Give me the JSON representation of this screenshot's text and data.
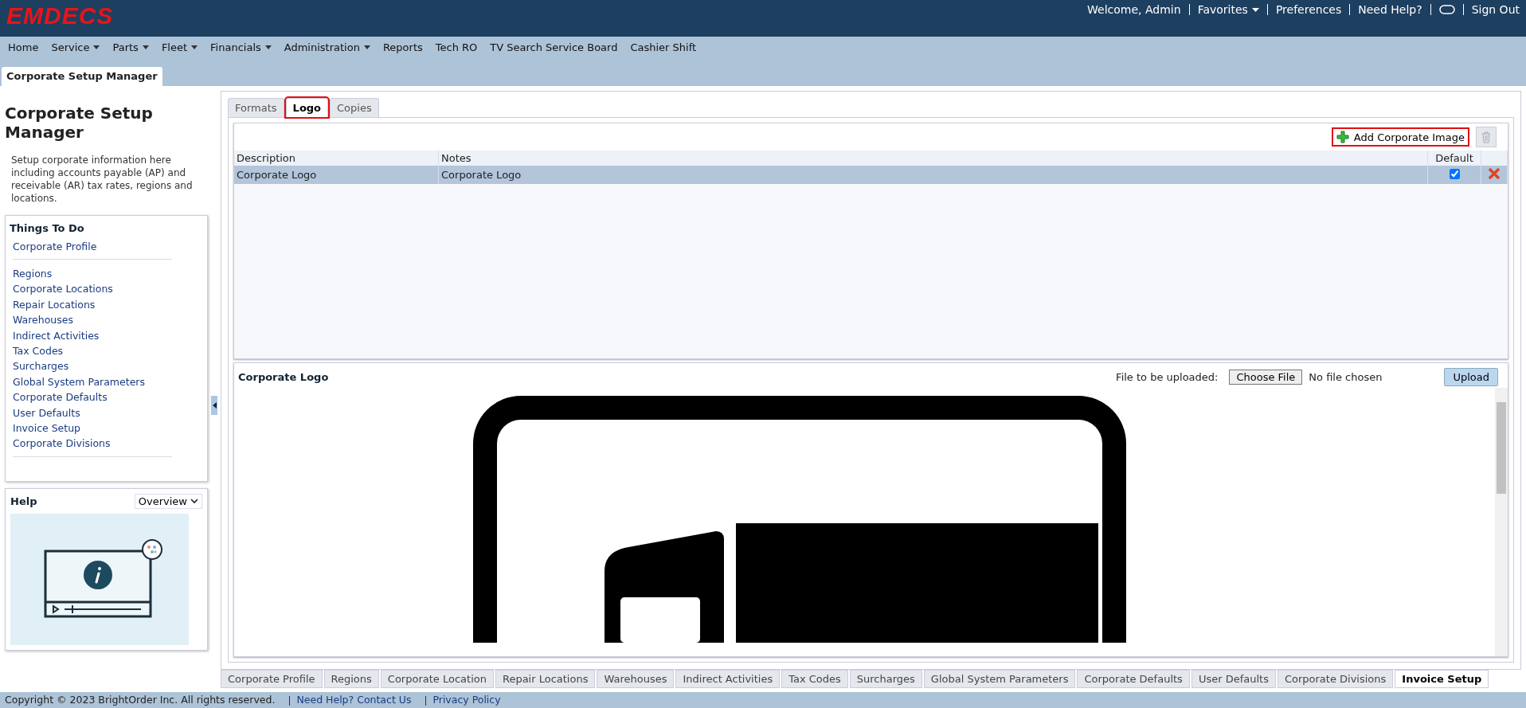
{
  "header": {
    "logo": "EMDECS",
    "welcome": "Welcome, Admin",
    "links": [
      {
        "label": "Favorites",
        "kind": "dropdown"
      },
      {
        "label": "Preferences",
        "kind": "link"
      },
      {
        "label": "Need Help?",
        "kind": "link"
      },
      {
        "kind": "toggle"
      },
      {
        "label": "Sign Out",
        "kind": "link"
      }
    ]
  },
  "nav": [
    {
      "label": "Home",
      "dropdown": false
    },
    {
      "label": "Service",
      "dropdown": true
    },
    {
      "label": "Parts",
      "dropdown": true
    },
    {
      "label": "Fleet",
      "dropdown": true
    },
    {
      "label": "Financials",
      "dropdown": true
    },
    {
      "label": "Administration",
      "dropdown": true
    },
    {
      "label": "Reports",
      "dropdown": false
    },
    {
      "label": "Tech RO",
      "dropdown": false
    },
    {
      "label": "TV Search Service Board",
      "dropdown": false
    },
    {
      "label": "Cashier Shift",
      "dropdown": false
    }
  ],
  "page_tab": "Corporate Setup Manager",
  "sidebar": {
    "title": "Corporate Setup Manager",
    "description": "Setup corporate information here including accounts payable (AP) and receivable (AR) tax rates, regions and locations.",
    "todo_title": "Things To Do",
    "todo_groups": [
      [
        "Corporate Profile"
      ],
      [
        "Regions",
        "Corporate Locations",
        "Repair Locations",
        "Warehouses",
        "Indirect Activities",
        "Tax Codes",
        "Surcharges",
        "Global System Parameters",
        "Corporate Defaults",
        "User Defaults",
        "Invoice Setup",
        "Corporate Divisions"
      ]
    ],
    "help_title": "Help",
    "help_select": "Overview"
  },
  "tabs": [
    {
      "label": "Formats",
      "selected": false
    },
    {
      "label": "Logo",
      "selected": true
    },
    {
      "label": "Copies",
      "selected": false
    }
  ],
  "add_button": "Add Corporate Image",
  "table": {
    "columns": [
      "Description",
      "Notes",
      "Default"
    ],
    "rows": [
      {
        "description": "Corporate Logo",
        "notes": "Corporate Logo",
        "default": true,
        "selected": true
      }
    ]
  },
  "detail": {
    "title": "Corporate Logo",
    "upload_label": "File to be uploaded:",
    "choose_file": "Choose File",
    "no_file": "No file chosen",
    "upload": "Upload"
  },
  "bottom_tabs": [
    {
      "label": "Corporate Profile",
      "selected": false
    },
    {
      "label": "Regions",
      "selected": false
    },
    {
      "label": "Corporate Location",
      "selected": false
    },
    {
      "label": "Repair Locations",
      "selected": false
    },
    {
      "label": "Warehouses",
      "selected": false
    },
    {
      "label": "Indirect Activities",
      "selected": false
    },
    {
      "label": "Tax Codes",
      "selected": false
    },
    {
      "label": "Surcharges",
      "selected": false
    },
    {
      "label": "Global System Parameters",
      "selected": false
    },
    {
      "label": "Corporate Defaults",
      "selected": false
    },
    {
      "label": "User Defaults",
      "selected": false
    },
    {
      "label": "Corporate Divisions",
      "selected": false
    },
    {
      "label": "Invoice Setup",
      "selected": true
    }
  ],
  "footer": {
    "copyright": "Copyright © 2023  BrightOrder Inc. All rights reserved.",
    "links": [
      "Need Help? Contact Us",
      "Privacy Policy"
    ]
  }
}
